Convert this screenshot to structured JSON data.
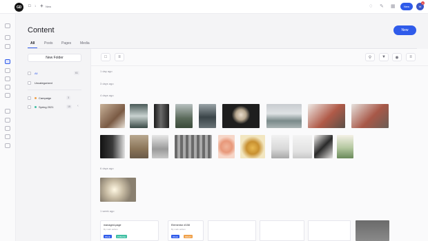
{
  "topbar": {
    "logo_text": "GD",
    "comments_icon": "comment-icon",
    "comments_count": "1",
    "new_icon": "plus-icon",
    "new_label": "New",
    "right_icons": [
      "bell-icon",
      "pen-icon",
      "grid-icon",
      "bookmark-icon"
    ],
    "new_button_label": "New",
    "avatar_initials": "W",
    "notification_count": "2"
  },
  "rail": {
    "icons": [
      "globe-icon",
      "layout-icon",
      "layers-icon",
      "media-icon",
      "page-icon",
      "form-icon",
      "calendar-icon",
      "table-icon",
      "palette-icon",
      "tools-icon",
      "plugin-icon",
      "settings-icon",
      "user-icon"
    ],
    "active_index": 3
  },
  "page": {
    "title": "Content",
    "new_button_label": "New",
    "tabs": [
      {
        "label": "All",
        "active": true
      },
      {
        "label": "Posts",
        "active": false
      },
      {
        "label": "Pages",
        "active": false
      },
      {
        "label": "Media",
        "active": false
      }
    ]
  },
  "folders": {
    "new_folder_label": "New Folder",
    "items": [
      {
        "label": "All",
        "count": "61",
        "active": true,
        "color": ""
      },
      {
        "label": "Uncategorized",
        "count": "",
        "active": false,
        "color": ""
      },
      {
        "label": "Campaign",
        "count": "3",
        "active": false,
        "color": "#f0a14a"
      },
      {
        "label": "Spring 2021",
        "count": "15",
        "active": false,
        "color": "#3fbfa3"
      }
    ]
  },
  "toolbar": {
    "left_icons": [
      "folder-icon",
      "list-icon"
    ],
    "right_icons": [
      "search-icon",
      "filter-icon",
      "eye-icon",
      "sliders-icon"
    ]
  },
  "groups": [
    {
      "label": "1 day ago"
    },
    {
      "label": "3 days ago"
    },
    {
      "label": "4 days ago"
    },
    {
      "label": "6 days ago"
    },
    {
      "label": "1 week ago"
    }
  ],
  "cards": [
    {
      "title": "managed-page",
      "subtitle": "By mark ashton",
      "badges": [
        {
          "text": "PAGE",
          "color": "#2f5bea"
        },
        {
          "text": "PUBLISH",
          "color": "#3fbfa3"
        }
      ]
    },
    {
      "title": "Elementor #158",
      "subtitle": "By mark ashton",
      "badges": [
        {
          "text": "PAGE",
          "color": "#2f5bea"
        },
        {
          "text": "DRAFT",
          "color": "#f0a14a"
        }
      ]
    }
  ],
  "colors": {
    "accent": "#2f5bea",
    "badge_publish": "#3fbfa3",
    "badge_draft": "#f0a14a"
  }
}
